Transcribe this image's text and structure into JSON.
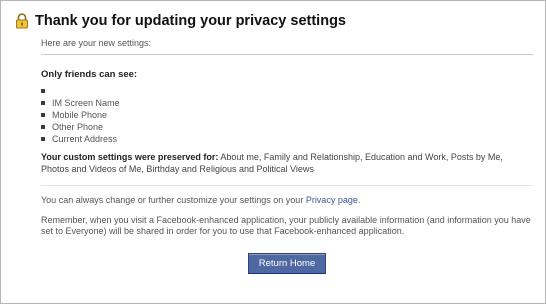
{
  "dialog": {
    "title": "Thank you for updating your privacy settings",
    "subtitle": "Here are your new settings:"
  },
  "friends_section": {
    "heading": "Only friends can see:",
    "items": [
      "",
      "IM Screen Name",
      "Mobile Phone",
      "Other Phone",
      "Current Address"
    ]
  },
  "custom": {
    "label": "Your custom settings were preserved for:",
    "text": " About me, Family and Relationship, Education and Work, Posts by Me, Photos and Videos of Me, Birthday and Religious and Political Views"
  },
  "privacy_note": {
    "text_before": "You can always change or further customize your settings on your ",
    "link": "Privacy page",
    "text_after": "."
  },
  "reminder": {
    "text": "Remember, when you visit a Facebook-enhanced application, your publicly available information (and information you have set to Everyone) will be shared in order for you to use that Facebook-enhanced application."
  },
  "actions": {
    "return_home": "Return Home"
  },
  "colors": {
    "link": "#3b5998",
    "button": "#4e69a2",
    "lock": "#f0c23b"
  },
  "icons": {
    "header": "lock-icon"
  }
}
